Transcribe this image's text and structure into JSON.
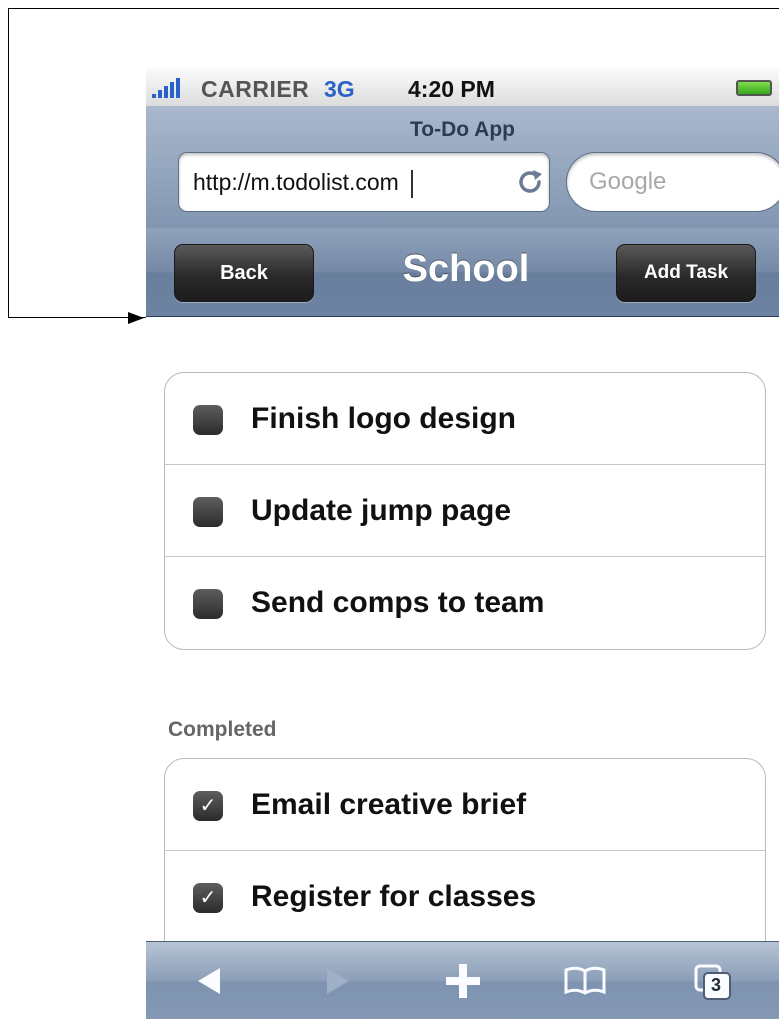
{
  "status_bar": {
    "carrier": "CARRIER",
    "network": "3G",
    "time": "4:20 PM"
  },
  "browser": {
    "page_title": "To-Do App",
    "url": "http://m.todolist.com",
    "search_placeholder": "Google"
  },
  "nav": {
    "back_label": "Back",
    "title": "School",
    "add_label": "Add Task"
  },
  "pending_tasks": [
    {
      "label": "Finish logo design",
      "done": false
    },
    {
      "label": "Update jump page",
      "done": false
    },
    {
      "label": "Send comps to team",
      "done": false
    }
  ],
  "completed_section": {
    "label": "Completed",
    "tasks": [
      {
        "label": "Email creative brief",
        "done": true
      },
      {
        "label": "Register for classes",
        "done": true
      }
    ]
  },
  "toolbar": {
    "tabs_count": "3",
    "icons": [
      "back-arrow-icon",
      "forward-arrow-icon",
      "plus-icon",
      "bookmarks-icon",
      "tabs-icon"
    ]
  },
  "colors": {
    "accent_blue": "#2a62c9",
    "nav_bar": "#7589a6",
    "button_dark": "#2a2a2a"
  }
}
